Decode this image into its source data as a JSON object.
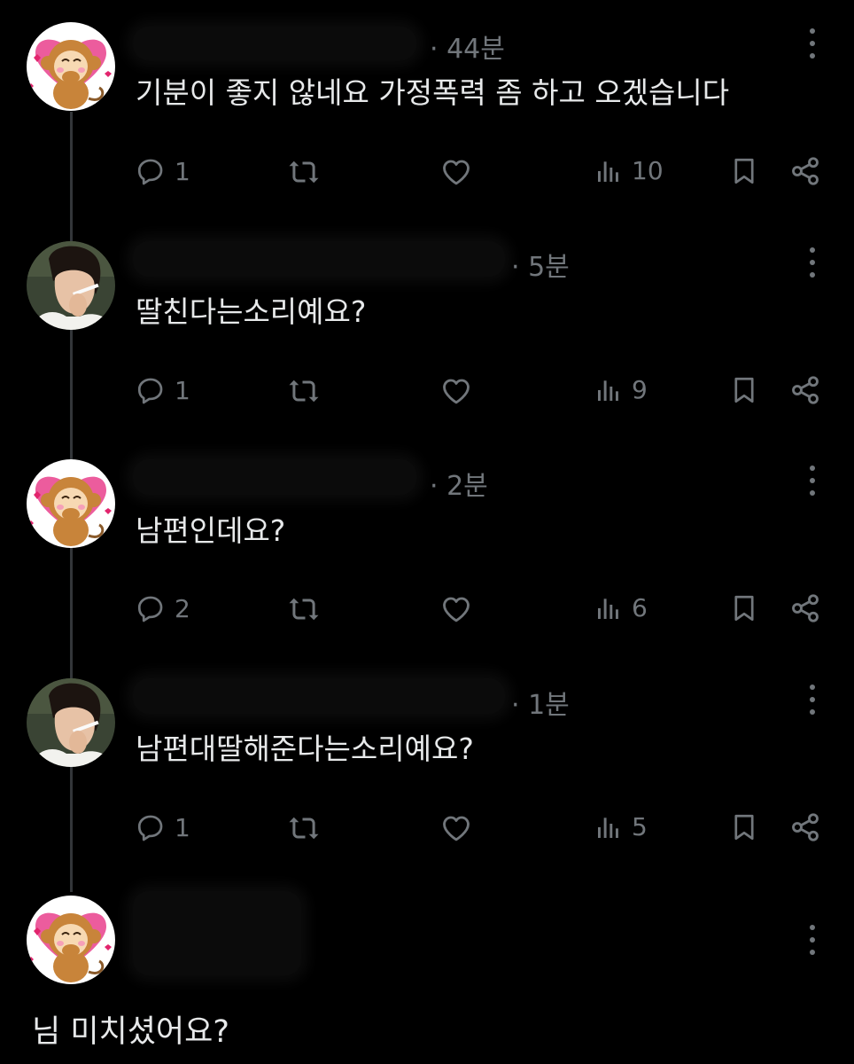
{
  "posts": [
    {
      "avatar": "monkey-avatar",
      "time": "· 44분",
      "text": "기분이 좋지 않네요 가정폭력 좀 하고 오겠습니다",
      "replies": "1",
      "views": "10"
    },
    {
      "avatar": "man-smoking-avatar",
      "time": "· 5분",
      "text": "딸친다는소리예요?",
      "replies": "1",
      "views": "9"
    },
    {
      "avatar": "monkey-avatar",
      "time": "· 2분",
      "text": "남편인데요?",
      "replies": "2",
      "views": "6"
    },
    {
      "avatar": "man-smoking-avatar",
      "time": "· 1분",
      "text": "남편대딸해준다는소리예요?",
      "replies": "1",
      "views": "5"
    }
  ],
  "focused_post": {
    "avatar": "monkey-avatar",
    "text": "님 미치셨어요?"
  },
  "icons": {
    "reply": "reply-icon",
    "repost": "repost-icon",
    "like": "heart-icon",
    "views": "views-icon",
    "bookmark": "bookmark-icon",
    "share": "share-icon",
    "more": "more-icon"
  },
  "colors": {
    "background": "#000000",
    "text": "#e7e9ea",
    "muted": "#71767b",
    "avatar_pink": "#e8559a"
  }
}
